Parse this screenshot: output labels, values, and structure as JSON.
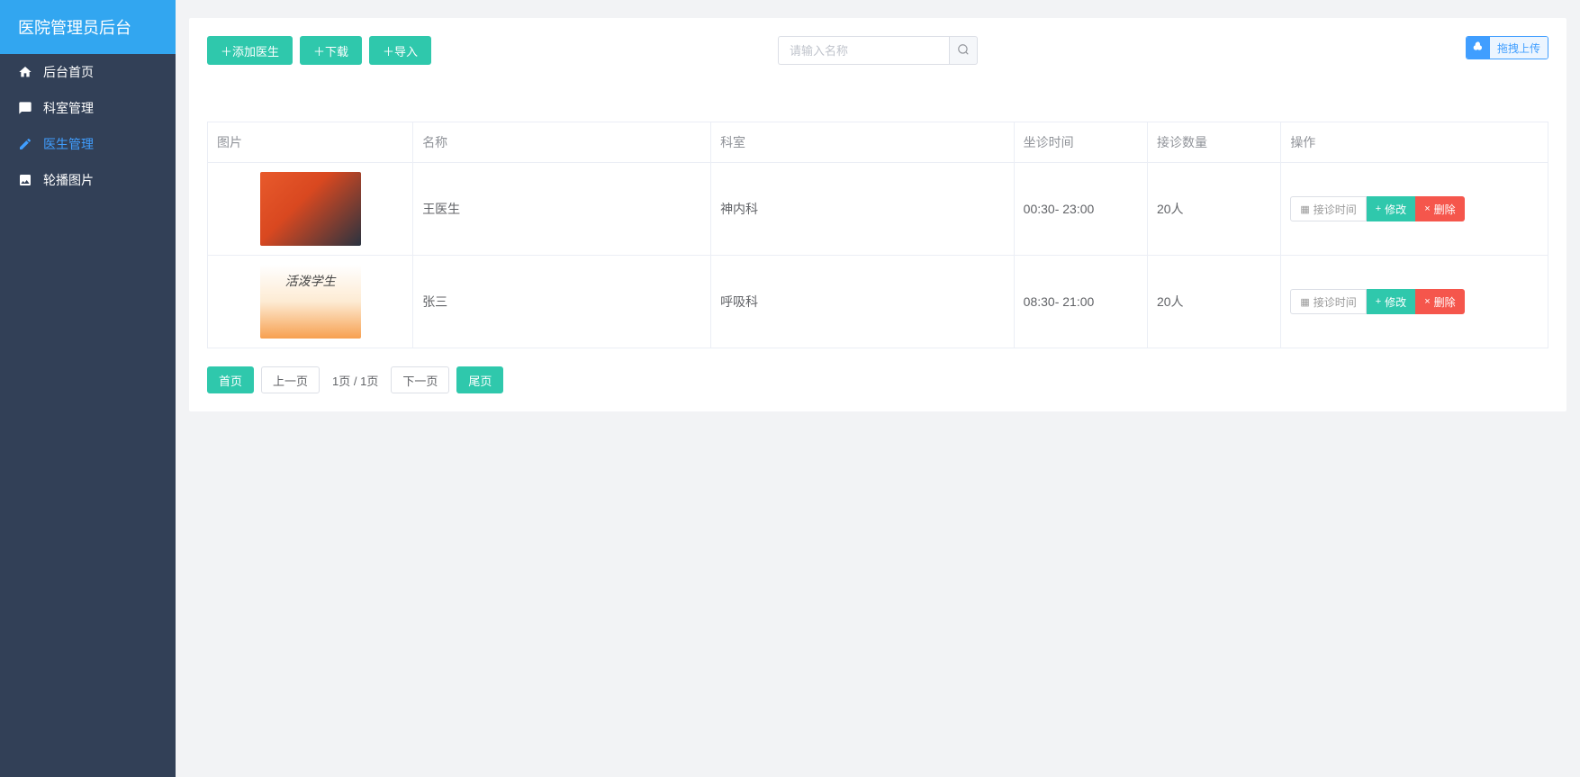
{
  "header": {
    "title": "医院管理员后台"
  },
  "sidebar": {
    "items": [
      {
        "icon": "home",
        "label": "后台首页"
      },
      {
        "icon": "chat",
        "label": "科室管理"
      },
      {
        "icon": "edit",
        "label": "医生管理",
        "active": true
      },
      {
        "icon": "image",
        "label": "轮播图片"
      }
    ]
  },
  "toolbar": {
    "add_label": "＋添加医生",
    "download_label": "＋下载",
    "import_label": "＋导入",
    "search_placeholder": "请输入名称",
    "upload_label": "拖拽上传"
  },
  "table": {
    "headers": {
      "image": "图片",
      "name": "名称",
      "department": "科室",
      "time": "坐诊时间",
      "count": "接诊数量",
      "ops": "操作"
    },
    "rows": [
      {
        "name": "王医生",
        "department": "神内科",
        "time": "00:30- 23:00",
        "count": "20人"
      },
      {
        "name": "张三",
        "department": "呼吸科",
        "time": "08:30- 21:00",
        "count": "20人"
      }
    ],
    "ops": {
      "schedule_label": "接诊时间",
      "edit_label": "修改",
      "delete_label": "删除"
    }
  },
  "pagination": {
    "first": "首页",
    "prev": "上一页",
    "info": "1页 / 1页",
    "next": "下一页",
    "last": "尾页"
  }
}
